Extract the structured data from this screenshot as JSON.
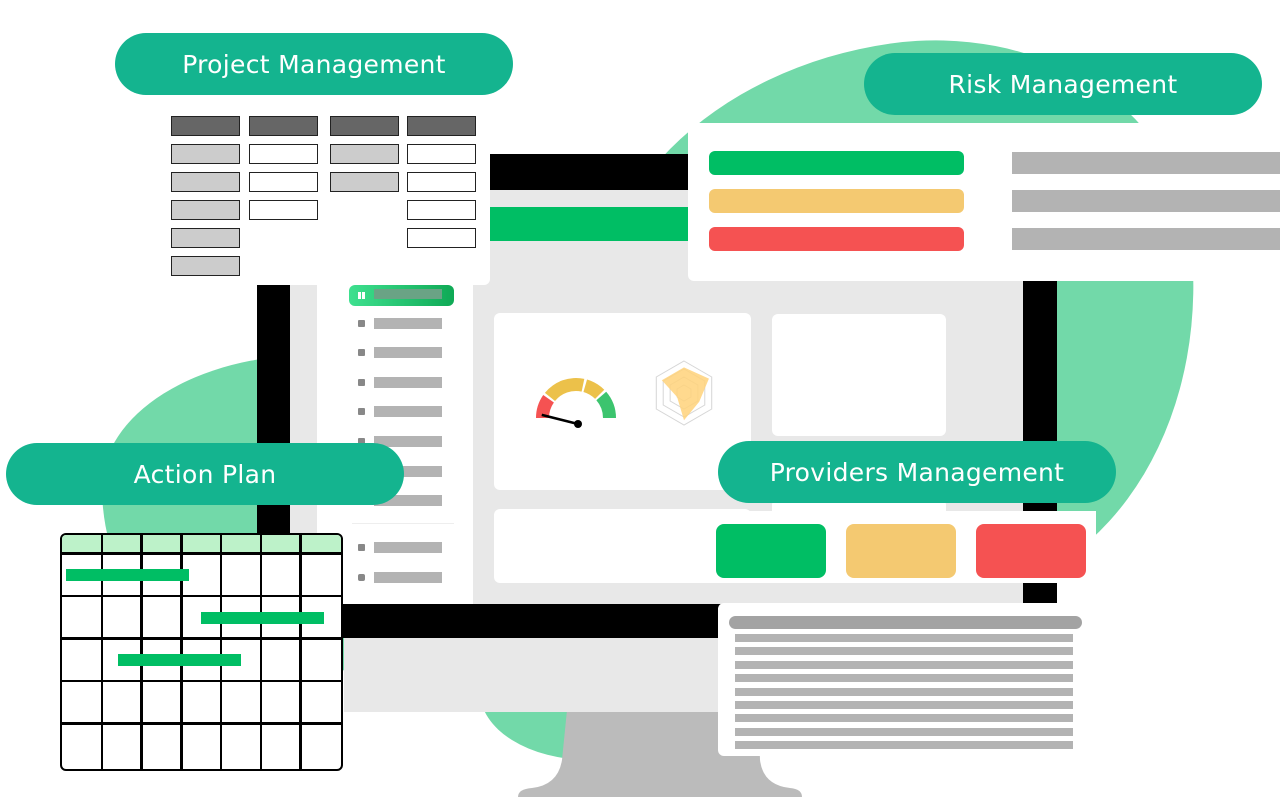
{
  "labels": {
    "project_management": "Project Management",
    "risk_management": "Risk Management",
    "action_plan": "Action Plan",
    "providers_management": "Providers Management"
  },
  "colors": {
    "pill": "#14b48f",
    "blob": "#72d9a9",
    "green": "#00be64",
    "yellow": "#f4c971",
    "red": "#f55252",
    "gray_bar": "#b3b3b3",
    "screen_bg": "#e8e8e8",
    "gantt_header": "#bdf2c9"
  },
  "project_management_board": {
    "columns": [
      [
        "dark",
        "light",
        "light",
        "light",
        "light",
        "light"
      ],
      [
        "dark",
        "white",
        "white",
        "white"
      ],
      [
        "dark",
        "light",
        "light"
      ],
      [
        "dark",
        "white",
        "white",
        "white",
        "white"
      ]
    ]
  },
  "risk_levels": [
    "green",
    "yellow",
    "red"
  ],
  "providers_status": [
    "green",
    "yellow",
    "red"
  ],
  "sidebar": {
    "items": [
      {
        "icon": "dashboard-icon",
        "active": true
      },
      {
        "icon": "chart-icon",
        "active": false
      },
      {
        "icon": "document-icon",
        "active": false
      },
      {
        "icon": "users-icon",
        "active": false
      },
      {
        "icon": "bag-icon",
        "active": false
      },
      {
        "icon": "settings-icon",
        "active": false
      },
      {
        "icon": "list-icon",
        "active": false
      },
      {
        "icon": "folder-icon",
        "active": false
      }
    ],
    "footer_items": [
      {
        "icon": "logout-icon"
      },
      {
        "icon": "help-icon"
      }
    ]
  },
  "gauge": {
    "needle_fraction": 0.1,
    "segments": [
      "red",
      "yellow",
      "yellow",
      "green"
    ]
  },
  "radar": {
    "values": [
      0.8,
      0.9,
      0.55,
      0.85,
      0.25,
      0.8
    ]
  },
  "gantt": {
    "columns": 7,
    "rows": 5,
    "tasks": [
      {
        "row": 0,
        "start": 0.1,
        "end": 3.2
      },
      {
        "row": 1,
        "start": 3.5,
        "end": 6.6
      },
      {
        "row": 2,
        "start": 1.4,
        "end": 4.5
      }
    ]
  }
}
